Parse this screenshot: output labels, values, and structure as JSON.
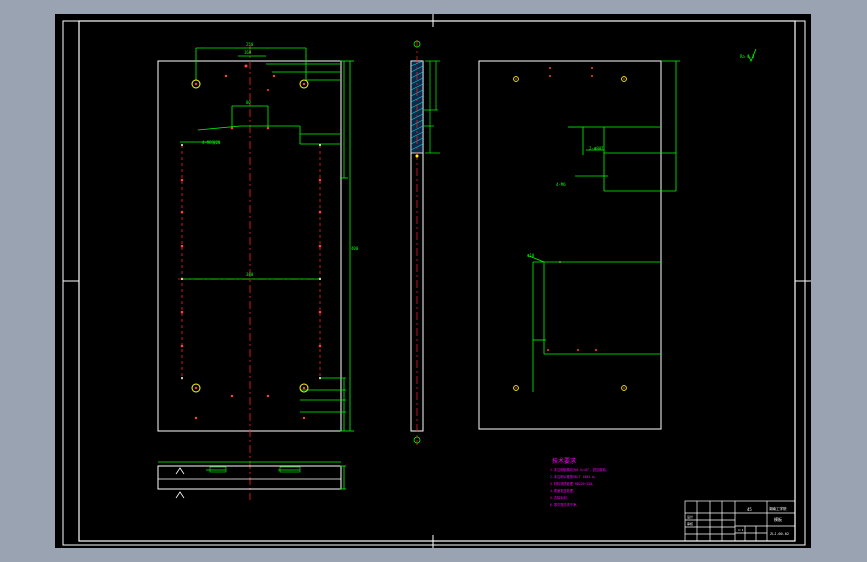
{
  "colors": {
    "page_frame": "#ffffff",
    "outline": "#ffffff",
    "dimension": "#00ff00",
    "center_line": "#ff0000",
    "hole": "#ffff00",
    "notes": "#ff00ff",
    "hatch": "#00ffff",
    "background": "#000000"
  },
  "drawing": {
    "tech_notes_title": "技术要求",
    "tech_notes": [
      "1.未注明倒角均为0.5×45°，锐边倒钝。",
      "2.未注明公差按GB/T 1804-m。",
      "3.材料调质处理 HB220~250。",
      "4.表面发蓝处理。",
      "5.去除毛刺。",
      "6.零件需清洗干净。"
    ],
    "roughness_symbol": "Ra 6.3",
    "title_block": {
      "part_name": "模板",
      "drawing_no": "ZLJ-00-02",
      "scale": "1:1",
      "school": "湖南工学院",
      "designer": "设计",
      "checker": "审核",
      "material": "45"
    }
  }
}
